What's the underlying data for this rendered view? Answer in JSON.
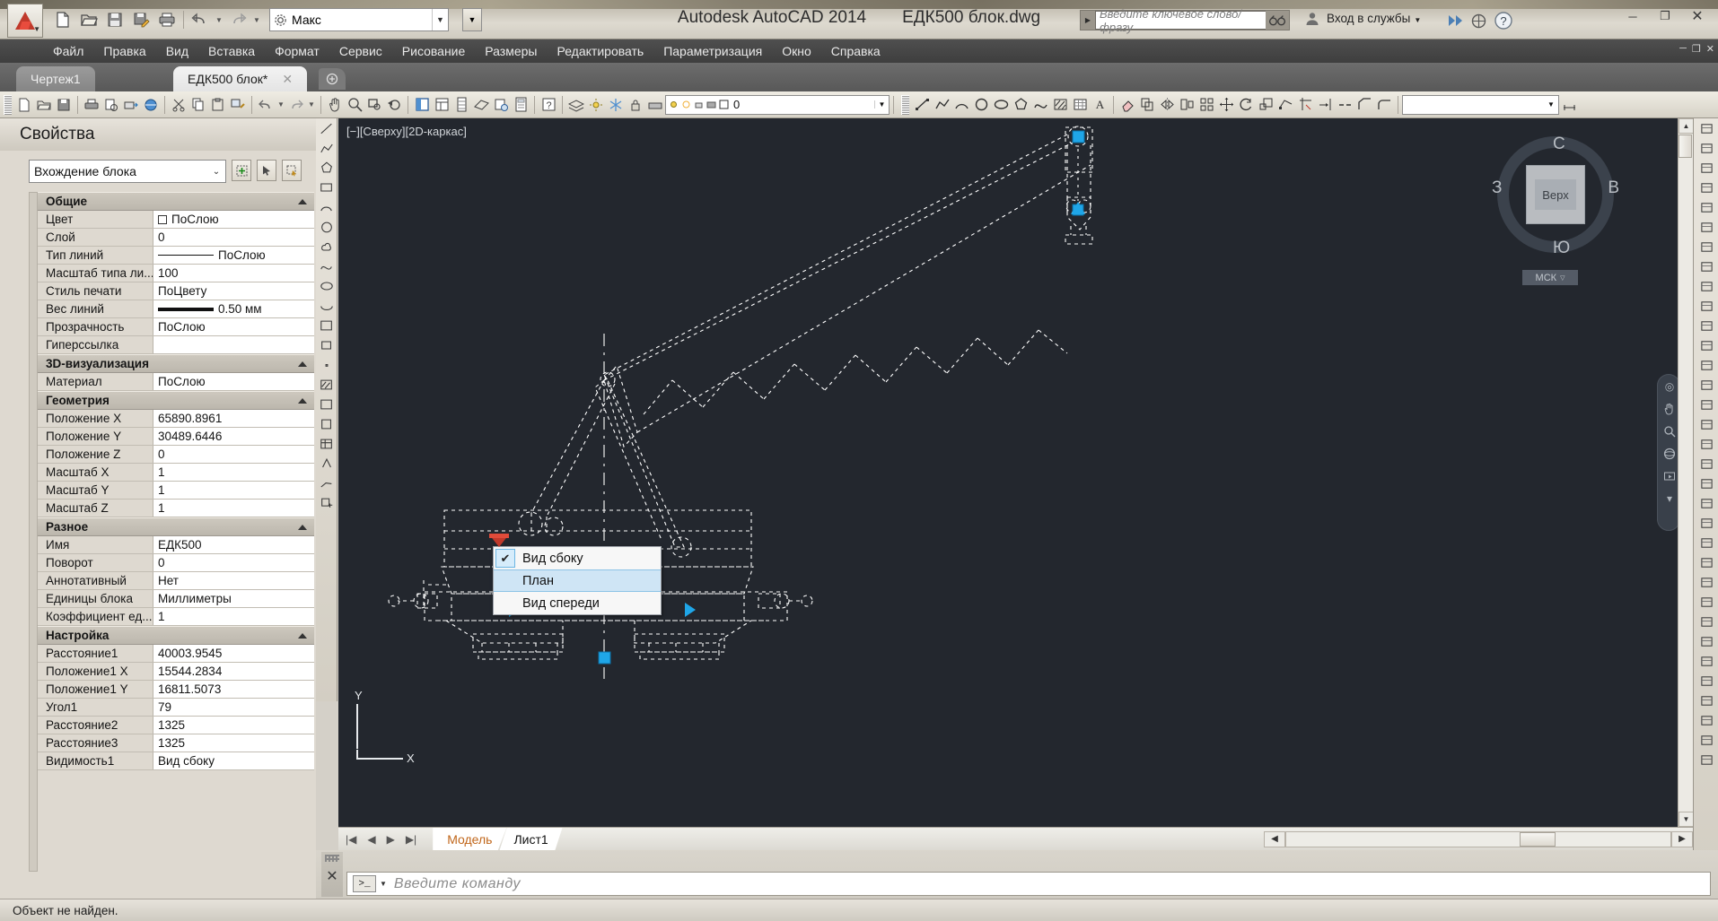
{
  "titlebar": {
    "app_title": "Autodesk AutoCAD 2014",
    "file_name": "ЕДК500 блок.dwg",
    "style_value": "Макс",
    "search_placeholder": "Введите ключевое слово/фразу",
    "signin_label": "Вход в службы",
    "qat_icons": [
      "new-icon",
      "open-icon",
      "save-icon",
      "save-as-icon",
      "plot-icon",
      "undo-icon",
      "redo-icon"
    ],
    "window_buttons": [
      "minimize",
      "maximize",
      "close"
    ]
  },
  "menubar": {
    "items": [
      {
        "label": "Файл"
      },
      {
        "label": "Правка"
      },
      {
        "label": "Вид"
      },
      {
        "label": "Вставка"
      },
      {
        "label": "Формат"
      },
      {
        "label": "Сервис"
      },
      {
        "label": "Рисование"
      },
      {
        "label": "Размеры"
      },
      {
        "label": "Редактировать"
      },
      {
        "label": "Параметризация"
      },
      {
        "label": "Окно"
      },
      {
        "label": "Справка"
      }
    ]
  },
  "file_tabs": [
    {
      "label": "Чертеж1",
      "active": false
    },
    {
      "label": "ЕДК500 блок*",
      "active": true
    }
  ],
  "toolbar": {
    "layer_value": "0",
    "linetype_value": "",
    "lineweight_value": ""
  },
  "properties": {
    "title": "Свойства",
    "selector_value": "Вхождение блока",
    "sections": [
      {
        "title": "Общие",
        "rows": [
          {
            "name": "Цвет",
            "value": "ПоСлою",
            "kind": "color"
          },
          {
            "name": "Слой",
            "value": "0",
            "kind": "text"
          },
          {
            "name": "Тип линий",
            "value": "ПоСлою",
            "kind": "linetype"
          },
          {
            "name": "Масштаб типа ли...",
            "value": "100",
            "kind": "text"
          },
          {
            "name": "Стиль печати",
            "value": "ПоЦвету",
            "kind": "text"
          },
          {
            "name": "Вес линий",
            "value": "0.50 мм",
            "kind": "lineweight"
          },
          {
            "name": "Прозрачность",
            "value": "ПоСлою",
            "kind": "text"
          },
          {
            "name": "Гиперссылка",
            "value": "",
            "kind": "text"
          }
        ]
      },
      {
        "title": "3D-визуализация",
        "rows": [
          {
            "name": "Материал",
            "value": "ПоСлою",
            "kind": "text"
          }
        ]
      },
      {
        "title": "Геометрия",
        "rows": [
          {
            "name": "Положение X",
            "value": "65890.8961",
            "kind": "text"
          },
          {
            "name": "Положение Y",
            "value": "30489.6446",
            "kind": "text"
          },
          {
            "name": "Положение Z",
            "value": "0",
            "kind": "text"
          },
          {
            "name": "Масштаб X",
            "value": "1",
            "kind": "text"
          },
          {
            "name": "Масштаб Y",
            "value": "1",
            "kind": "text"
          },
          {
            "name": "Масштаб Z",
            "value": "1",
            "kind": "text"
          }
        ]
      },
      {
        "title": "Разное",
        "rows": [
          {
            "name": "Имя",
            "value": "ЕДК500",
            "kind": "text"
          },
          {
            "name": "Поворот",
            "value": "0",
            "kind": "text"
          },
          {
            "name": "Аннотативный",
            "value": "Нет",
            "kind": "text"
          },
          {
            "name": "Единицы блока",
            "value": "Миллиметры",
            "kind": "text"
          },
          {
            "name": "Коэффициент ед...",
            "value": "1",
            "kind": "text"
          }
        ]
      },
      {
        "title": "Настройка",
        "rows": [
          {
            "name": "Расстояние1",
            "value": "40003.9545",
            "kind": "text"
          },
          {
            "name": "Положение1 X",
            "value": "15544.2834",
            "kind": "text"
          },
          {
            "name": "Положение1 Y",
            "value": "16811.5073",
            "kind": "text"
          },
          {
            "name": "Угол1",
            "value": "79",
            "kind": "text"
          },
          {
            "name": "Расстояние2",
            "value": "1325",
            "kind": "text"
          },
          {
            "name": "Расстояние3",
            "value": "1325",
            "kind": "text"
          },
          {
            "name": "Видимость1",
            "value": "Вид сбоку",
            "kind": "text"
          }
        ]
      }
    ]
  },
  "canvas": {
    "viewport_label": "[−][Сверху][2D-каркас]",
    "background_color": "#23272e",
    "grip_color": "#1fa6e8",
    "viewcube": {
      "face_label": "Верх",
      "north": "С",
      "south": "Ю",
      "west": "З",
      "east": "В",
      "ucs_label": "МСК"
    },
    "ucs_axes": {
      "x": "X",
      "y": "Y"
    }
  },
  "context_menu": {
    "items": [
      {
        "label": "Вид сбоку",
        "checked": true,
        "hover": false
      },
      {
        "label": "План",
        "checked": false,
        "hover": true
      },
      {
        "label": "Вид спереди",
        "checked": false,
        "hover": false
      }
    ]
  },
  "layout_tabs": {
    "items": [
      {
        "label": "Модель",
        "active": true
      },
      {
        "label": "Лист1",
        "active": false
      }
    ]
  },
  "command_line": {
    "placeholder": "Введите команду",
    "prompt_icon": ">_"
  },
  "statusbar": {
    "message": "Объект не найден."
  }
}
